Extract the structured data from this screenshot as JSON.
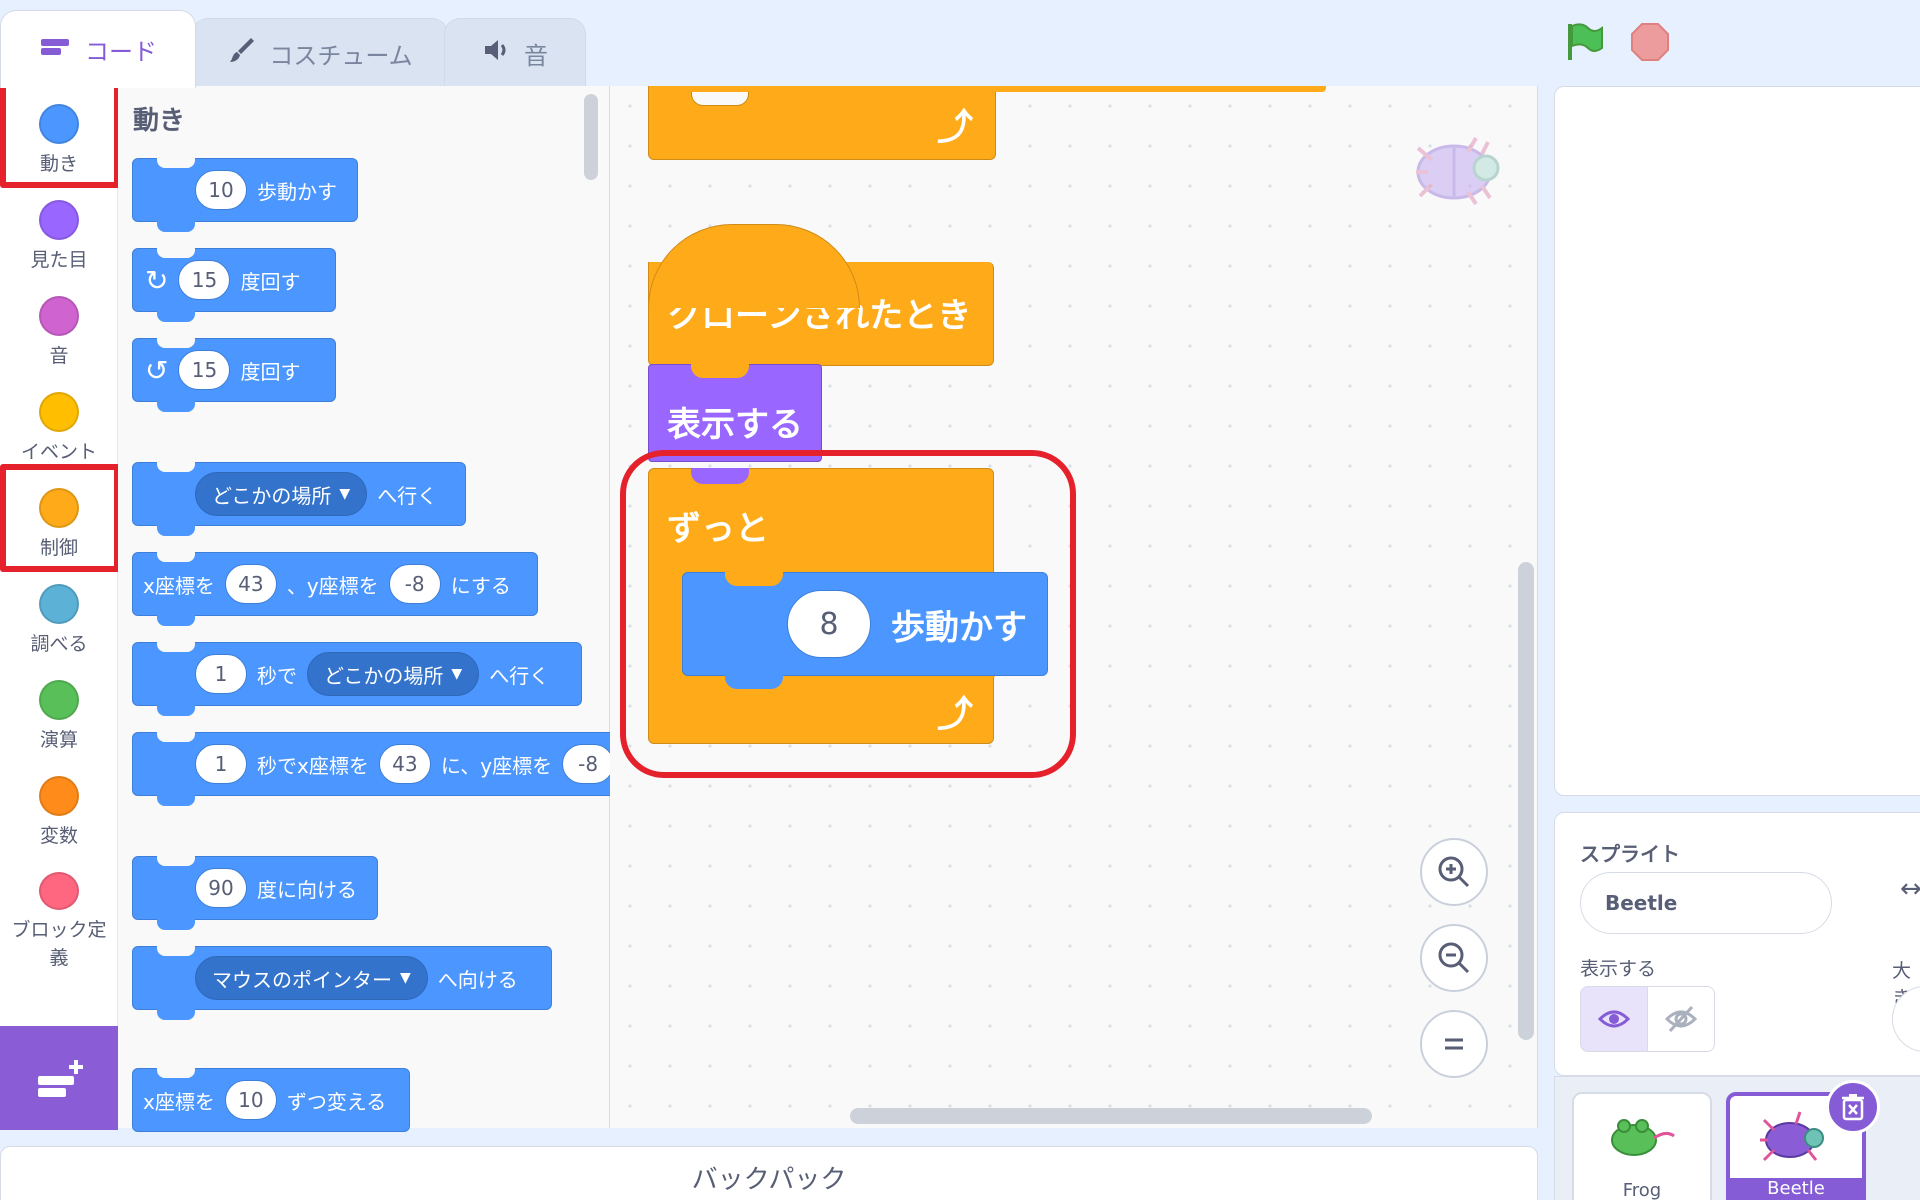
{
  "tabs": [
    {
      "label": "コード",
      "icon": "code-icon"
    },
    {
      "label": "コスチューム",
      "icon": "brush-icon"
    },
    {
      "label": "音",
      "icon": "speaker-icon"
    }
  ],
  "categories": [
    {
      "label": "動き",
      "color": "#4c97ff"
    },
    {
      "label": "見た目",
      "color": "#9966ff"
    },
    {
      "label": "音",
      "color": "#cf63cf"
    },
    {
      "label": "イベント",
      "color": "#ffbf00"
    },
    {
      "label": "制御",
      "color": "#ffab19"
    },
    {
      "label": "調べる",
      "color": "#5cb1d6"
    },
    {
      "label": "演算",
      "color": "#59c059"
    },
    {
      "label": "変数",
      "color": "#ff8c1a"
    },
    {
      "label": "ブロック定義",
      "color": "#ff6680"
    }
  ],
  "palette": {
    "title": "動き",
    "move": {
      "value": "10",
      "text": "歩動かす"
    },
    "turn_right": {
      "value": "15",
      "text": "度回す"
    },
    "turn_left": {
      "value": "15",
      "text": "度回す"
    },
    "goto": {
      "dropdown": "どこかの場所",
      "text": "へ行く"
    },
    "goto_xy": {
      "x_label": "x座標を",
      "x": "43",
      "y_label": "、y座標を",
      "y": "-8",
      "suffix": "にする"
    },
    "glide": {
      "value": "1",
      "mid": "秒で",
      "dropdown": "どこかの場所",
      "text": "へ行く"
    },
    "glide_xy": {
      "value": "1",
      "mid": "秒でx座標を",
      "x": "43",
      "y_label": "に、y座標を",
      "y": "-8"
    },
    "point": {
      "value": "90",
      "text": "度に向ける"
    },
    "point_towards": {
      "dropdown": "マウスのポインター",
      "text": "へ向ける"
    },
    "change_x": {
      "label": "x座標を",
      "value": "10",
      "text": "ずつ変える"
    }
  },
  "script": {
    "hat": "クローンされたとき",
    "show": "表示する",
    "forever": "ずっと",
    "move_value": "8",
    "move_text": "歩動かす"
  },
  "backpack": "バックパック",
  "sprite": {
    "label": "スプライト",
    "name": "Beetle",
    "show_label": "表示する",
    "size_label": "大き"
  },
  "sprites": [
    {
      "name": "Frog"
    },
    {
      "name": "Beetle"
    }
  ],
  "colors": {
    "accent": "#855cd6",
    "motion": "#4c97ff",
    "control": "#ffab19",
    "looks": "#9966ff",
    "highlight": "#e5212c"
  }
}
